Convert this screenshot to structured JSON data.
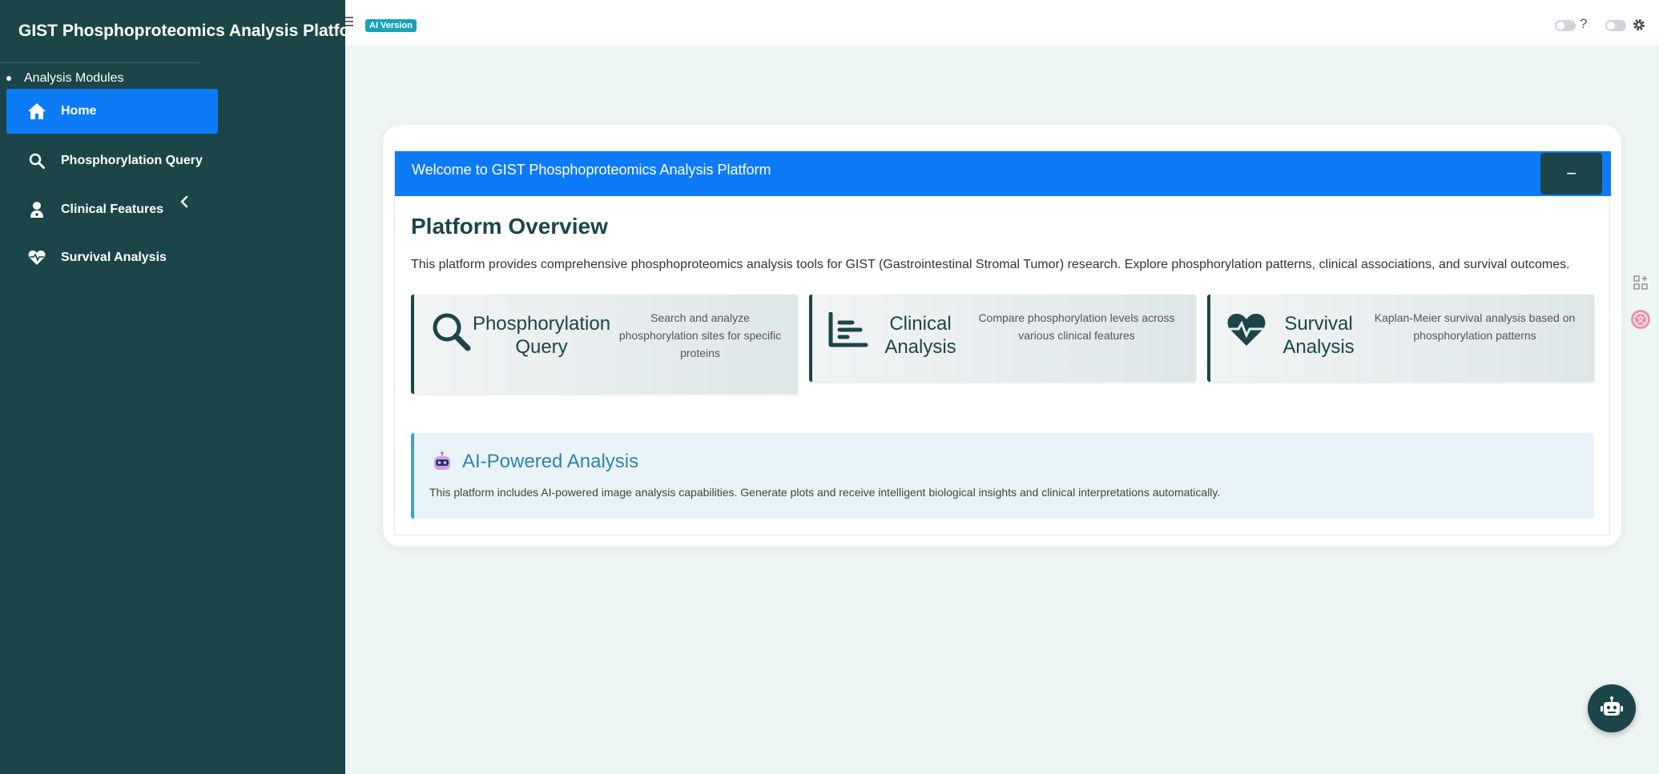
{
  "app": {
    "brand": "GIST Phosphoproteomics Analysis Platform"
  },
  "sidebar": {
    "section_label": "Analysis Modules",
    "items": [
      {
        "label": "Home",
        "icon": "home-icon",
        "active": true
      },
      {
        "label": "Phosphorylation Query",
        "icon": "search-icon",
        "active": false
      },
      {
        "label": "Clinical Features",
        "icon": "user-doctor-icon",
        "active": false
      },
      {
        "label": "Survival Analysis",
        "icon": "heart-pulse-icon",
        "active": false
      }
    ]
  },
  "topbar": {
    "badge": "AI Version",
    "help": "?"
  },
  "welcome": {
    "header": "Welcome to GIST Phosphoproteomics Analysis Platform",
    "collapse_label": "−",
    "title": "Platform Overview",
    "description": "This platform provides comprehensive phosphoproteomics analysis tools for GIST (Gastrointestinal Stromal Tumor) research. Explore phosphorylation patterns, clinical associations, and survival outcomes."
  },
  "features": [
    {
      "title_1": "Phosphorylation",
      "title_2": "Query",
      "desc_1": "Search and analyze",
      "desc_2": "phosphorylation sites for specific",
      "desc_3": "proteins",
      "icon": "search-icon"
    },
    {
      "title_1": "Clinical",
      "title_2": "Analysis",
      "desc_1": "Compare phosphorylation levels across",
      "desc_2": "various clinical features",
      "icon": "chart-bar-icon"
    },
    {
      "title_1": "Survival",
      "title_2": "Analysis",
      "desc_1": "Kaplan-Meier survival analysis based on",
      "desc_2": "phosphorylation patterns",
      "icon": "heart-pulse-icon"
    }
  ],
  "ai_panel": {
    "title": "AI-Powered Analysis",
    "description": "This platform includes AI-powered image analysis capabilities. Generate plots and receive intelligent biological insights and clinical interpretations automatically.",
    "icon": "robot-emoji-icon"
  },
  "colors": {
    "sidebar_bg": "#1c4549",
    "primary": "#0d7bf5",
    "badge": "#17a2b8",
    "ai_accent": "#2f86a8"
  }
}
